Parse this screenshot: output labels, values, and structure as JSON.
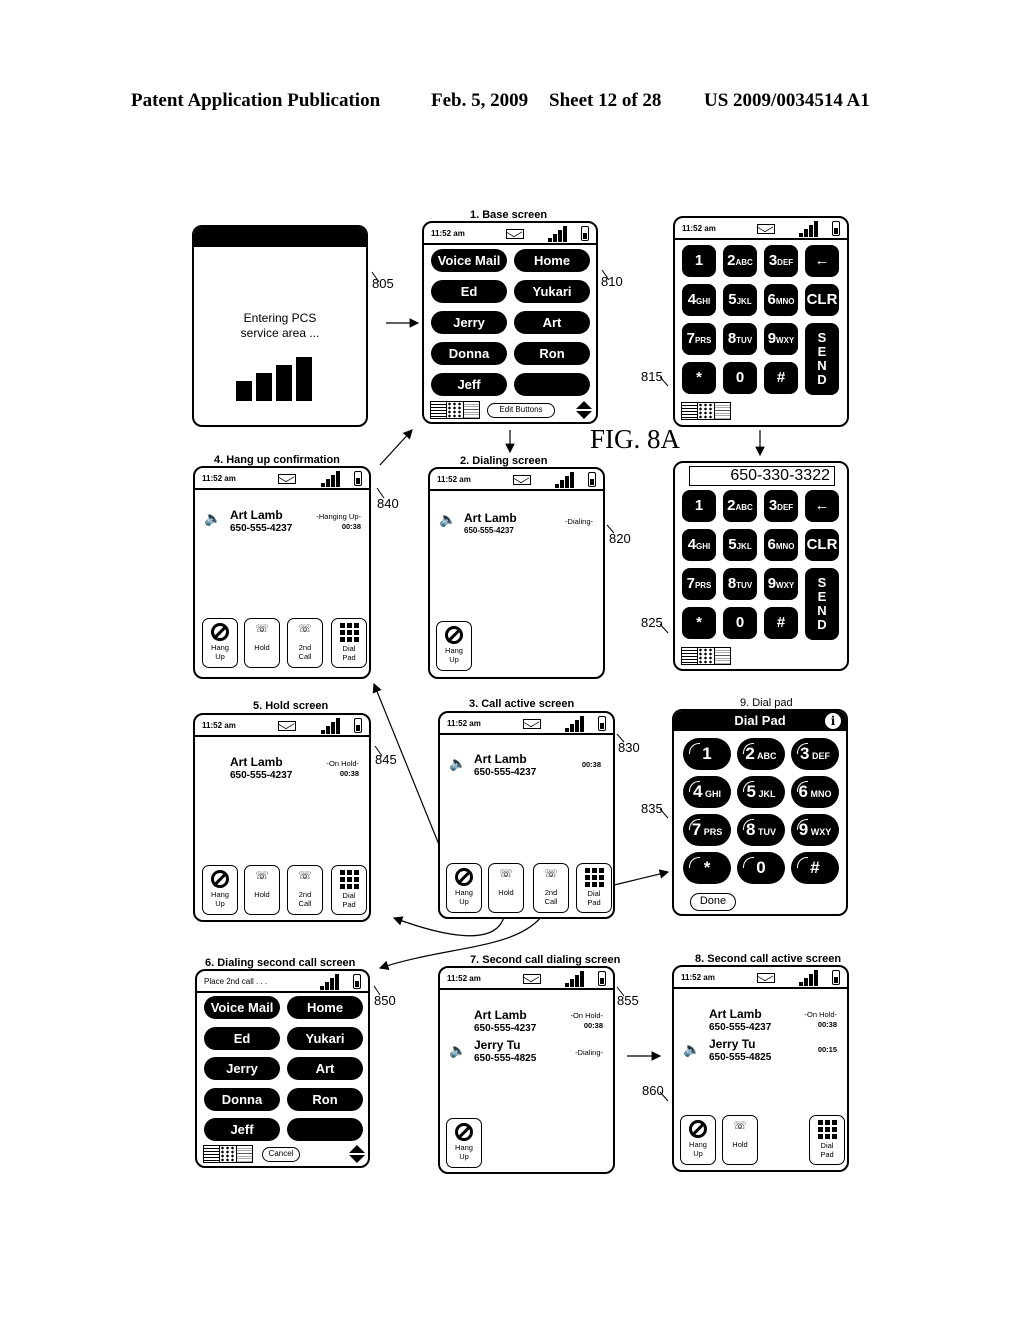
{
  "header": {
    "publication": "Patent Application Publication",
    "date": "Feb. 5, 2009",
    "sheet": "Sheet 12 of 28",
    "number": "US 2009/0034514 A1"
  },
  "figure_label": "FIG. 8A",
  "status_bar": {
    "time": "11:52 am",
    "mail_icon": "envelope-icon",
    "signal_icon": "signal-bars-icon",
    "battery_icon": "battery-icon"
  },
  "screens": {
    "s805": {
      "ref": "805",
      "text_line1": "Entering PCS",
      "text_line2": "service area ..."
    },
    "s810": {
      "ref": "810",
      "caption": "1. Base screen",
      "buttons": [
        "Voice Mail",
        "Home",
        "Ed",
        "Yukari",
        "Jerry",
        "Art",
        "Donna",
        "Ron",
        "Jeff",
        ""
      ],
      "edit_label": "Edit Buttons"
    },
    "s815": {
      "ref": "815",
      "keys": [
        {
          "d": "1",
          "l": ""
        },
        {
          "d": "2",
          "l": "ABC"
        },
        {
          "d": "3",
          "l": "DEF"
        },
        {
          "d": "←",
          "l": ""
        },
        {
          "d": "4",
          "l": "GHI"
        },
        {
          "d": "5",
          "l": "JKL"
        },
        {
          "d": "6",
          "l": "MNO"
        },
        {
          "d": "CLR",
          "l": ""
        },
        {
          "d": "7",
          "l": "PRS"
        },
        {
          "d": "8",
          "l": "TUV"
        },
        {
          "d": "9",
          "l": "WXY"
        },
        {
          "d": "*",
          "l": ""
        },
        {
          "d": "0",
          "l": ""
        },
        {
          "d": "#",
          "l": ""
        }
      ],
      "send_label": "S E N D"
    },
    "s820": {
      "ref": "820",
      "caption": "2. Dialing screen",
      "name": "Art Lamb",
      "number": "650-555-4237",
      "status": "-Dialing-",
      "hangup": [
        "Hang",
        "Up"
      ]
    },
    "s825": {
      "ref": "825",
      "display": "650-330-3322"
    },
    "s830": {
      "ref": "830",
      "caption": "3. Call active screen",
      "name": "Art Lamb",
      "number": "650-555-4237",
      "timer": "00:38"
    },
    "s835": {
      "ref": "835",
      "caption": "9. Dial pad",
      "title": "Dial Pad",
      "info_icon": "i",
      "keys": [
        {
          "d": "1",
          "l": ""
        },
        {
          "d": "2",
          "l": "ABC"
        },
        {
          "d": "3",
          "l": "DEF"
        },
        {
          "d": "4",
          "l": "GHI"
        },
        {
          "d": "5",
          "l": "JKL"
        },
        {
          "d": "6",
          "l": "MNO"
        },
        {
          "d": "7",
          "l": "PRS"
        },
        {
          "d": "8",
          "l": "TUV"
        },
        {
          "d": "9",
          "l": "WXY"
        },
        {
          "d": "*",
          "l": ""
        },
        {
          "d": "0",
          "l": ""
        },
        {
          "d": "#",
          "l": ""
        }
      ],
      "done_label": "Done"
    },
    "s840": {
      "ref": "840",
      "caption": "4. Hang up confirmation",
      "name": "Art Lamb",
      "number": "650-555-4237",
      "status": "-Hanging Up-",
      "timer": "00:38"
    },
    "s845": {
      "ref": "845",
      "caption": "5. Hold screen",
      "name": "Art Lamb",
      "number": "650-555-4237",
      "status": "-On Hold-",
      "timer": "00:38"
    },
    "s850": {
      "ref": "850",
      "caption": "6. Dialing second call screen",
      "status_text": "Place 2nd call . . .",
      "buttons": [
        "Voice Mail",
        "Home",
        "Ed",
        "Yukari",
        "Jerry",
        "Art",
        "Donna",
        "Ron",
        "Jeff",
        ""
      ],
      "cancel_label": "Cancel"
    },
    "s855": {
      "ref": "855",
      "caption": "7. Second call dialing screen",
      "call1": {
        "name": "Art Lamb",
        "number": "650-555-4237",
        "status": "-On Hold-",
        "timer": "00:38"
      },
      "call2": {
        "name": "Jerry Tu",
        "number": "650-555-4825",
        "status": "-Dialing-"
      }
    },
    "s860": {
      "ref": "860",
      "caption": "8. Second call active screen",
      "call1": {
        "name": "Art Lamb",
        "number": "650-555-4237",
        "status": "-On Hold-",
        "timer": "00:38"
      },
      "call2": {
        "name": "Jerry Tu",
        "number": "650-555-4825",
        "timer": "00:15"
      }
    }
  },
  "call_buttons": {
    "hangup": [
      "Hang",
      "Up"
    ],
    "hold": "Hold",
    "second_call": [
      "2nd",
      "Call"
    ],
    "dialpad": [
      "Dial",
      "Pad"
    ]
  }
}
